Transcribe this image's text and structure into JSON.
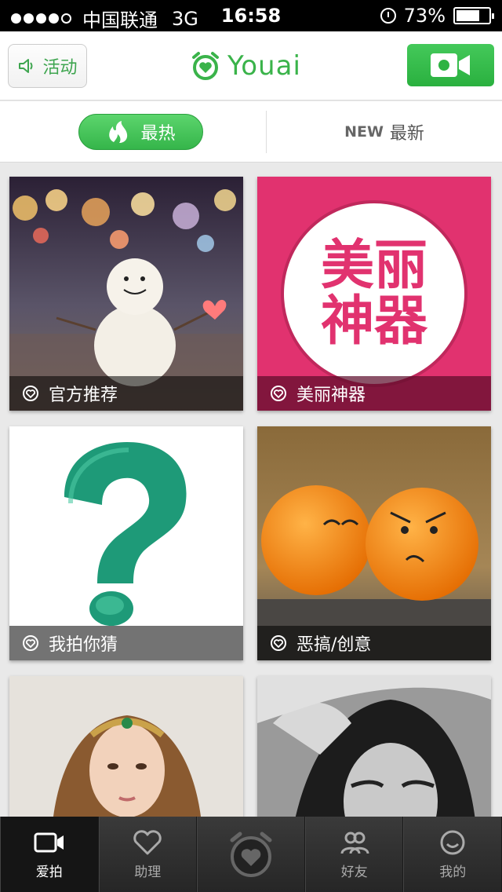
{
  "status_bar": {
    "carrier": "中国联通",
    "network": "3G",
    "time": "16:58",
    "battery": "73%",
    "battery_level": 0.73
  },
  "header": {
    "activity_label": "活动",
    "logo_text": "Youai",
    "brand_color": "#3ab34a"
  },
  "tabs": {
    "hot_label": "最热",
    "new_tag": "NEW",
    "new_label": "最新"
  },
  "cards": [
    {
      "caption": "官方推荐"
    },
    {
      "caption": "美丽神器",
      "badge_text_1": "美丽",
      "badge_text_2": "神器"
    },
    {
      "caption": "我拍你猜"
    },
    {
      "caption": "恶搞/创意"
    },
    {
      "caption": ""
    },
    {
      "caption": ""
    }
  ],
  "tabbar": {
    "items": [
      {
        "label": "爱拍",
        "icon": "video-camera-icon",
        "active": true
      },
      {
        "label": "助理",
        "icon": "heart-icon"
      },
      {
        "label": "",
        "icon": "alarm-clock-heart-icon"
      },
      {
        "label": "好友",
        "icon": "friends-icon"
      },
      {
        "label": "我的",
        "icon": "smile-icon"
      }
    ]
  }
}
